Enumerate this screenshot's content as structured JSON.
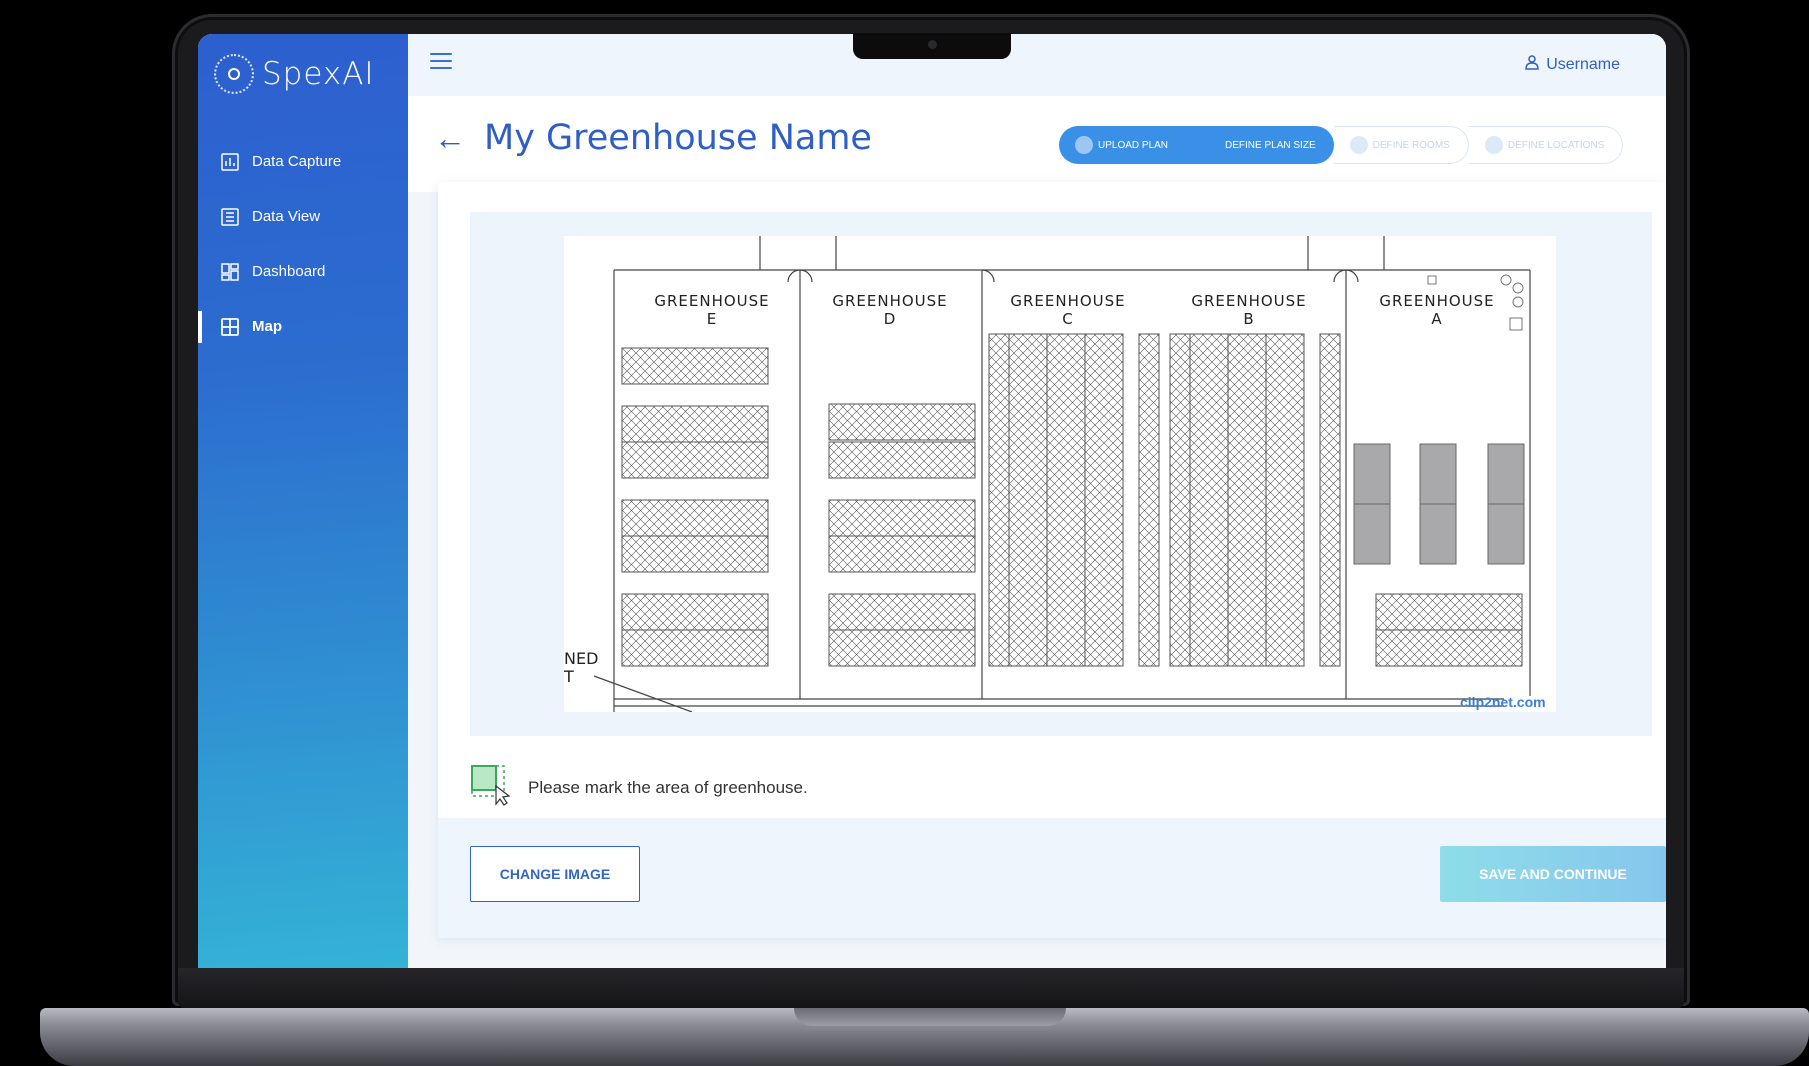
{
  "app": {
    "logo_text": "SpexAI"
  },
  "sidebar": {
    "items": [
      {
        "label": "Data Capture",
        "icon": "bar-chart-icon"
      },
      {
        "label": "Data View",
        "icon": "list-icon"
      },
      {
        "label": "Dashboard",
        "icon": "dashboard-icon"
      },
      {
        "label": "Map",
        "icon": "map-grid-icon",
        "active": true
      }
    ]
  },
  "topbar": {
    "username": "Username",
    "menu_icon": "hamburger-icon",
    "user_icon": "user-icon"
  },
  "header": {
    "back_icon": "arrow-left-icon",
    "title": "My Greenhouse Name"
  },
  "stepper": {
    "steps": [
      {
        "label": "UPLOAD PLAN",
        "status": "done"
      },
      {
        "label": "DEFINE PLAN SIZE",
        "status": "current"
      },
      {
        "label": "DEFINE ROOMS",
        "status": "pending"
      },
      {
        "label": "DEFINE LOCATIONS",
        "status": "pending"
      }
    ],
    "active_color": "#3a8fe6"
  },
  "plan": {
    "greenhouses": [
      {
        "line1": "GREENHOUSE",
        "line2": "E"
      },
      {
        "line1": "GREENHOUSE",
        "line2": "D"
      },
      {
        "line1": "GREENHOUSE",
        "line2": "C"
      },
      {
        "line1": "GREENHOUSE",
        "line2": "B"
      },
      {
        "line1": "GREENHOUSE",
        "line2": "A"
      }
    ],
    "edge_text_1": "NED",
    "edge_text_2": "T",
    "watermark": "clip2net.com"
  },
  "hint": {
    "text": "Please mark the area of greenhouse.",
    "icon": "select-area-icon"
  },
  "actions": {
    "change_image": "CHANGE IMAGE",
    "save_continue": "SAVE AND CONTINUE"
  },
  "colors": {
    "brand_blue": "#2f5fc4",
    "sidebar_top": "#2d5fcf",
    "sidebar_bottom": "#34b3d6",
    "save_button": "#8fdde8"
  }
}
